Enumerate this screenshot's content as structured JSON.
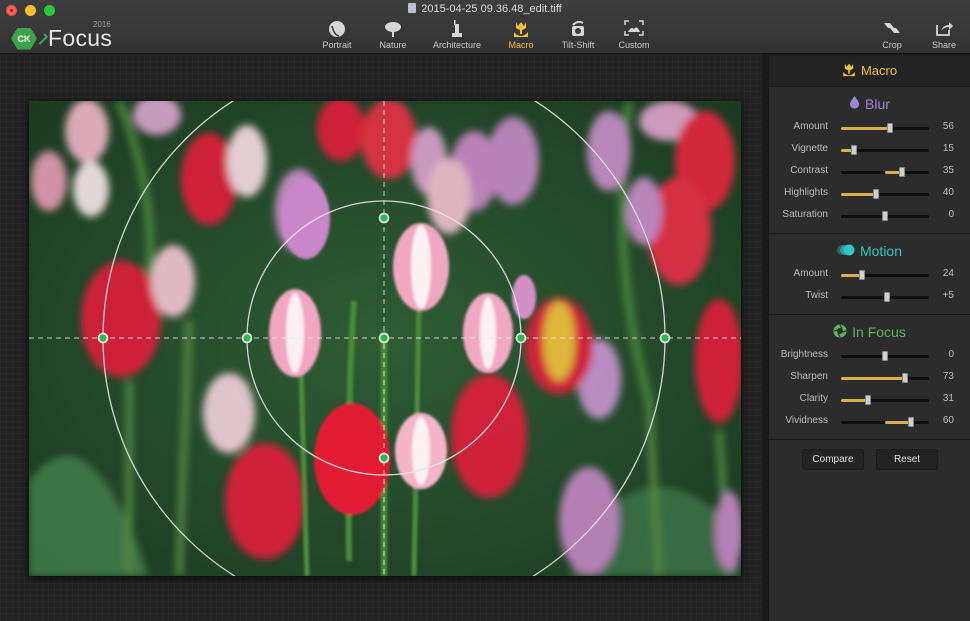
{
  "window": {
    "document_title": "2015-04-25 09.36.48_edit.tiff"
  },
  "app": {
    "logo_badge": "CK",
    "name": "Focus",
    "year": "2016"
  },
  "toolbar": {
    "presets": [
      {
        "label": "Portrait",
        "icon": "portrait-icon",
        "active": false
      },
      {
        "label": "Nature",
        "icon": "tree-icon",
        "active": false
      },
      {
        "label": "Architecture",
        "icon": "statue-icon",
        "active": false
      },
      {
        "label": "Macro",
        "icon": "flower-icon",
        "active": true
      },
      {
        "label": "Tilt-Shift",
        "icon": "tilt-shift-icon",
        "active": false
      },
      {
        "label": "Custom",
        "icon": "custom-icon",
        "active": false
      }
    ],
    "crop_label": "Crop",
    "share_label": "Share",
    "accent_color": "#f2c12e"
  },
  "sidebar": {
    "header": "Macro",
    "sections": [
      {
        "title": "Blur",
        "icon": "droplet-icon",
        "color": "#9b86d6",
        "sliders": [
          {
            "label": "Amount",
            "value": "56",
            "fill_from": 0,
            "fill_to": 0.56
          },
          {
            "label": "Vignette",
            "value": "15",
            "fill_from": 0,
            "fill_to": 0.15
          },
          {
            "label": "Contrast",
            "value": "35",
            "fill_from": 0.5,
            "fill_to": 0.69
          },
          {
            "label": "Highlights",
            "value": "40",
            "fill_from": 0,
            "fill_to": 0.4
          },
          {
            "label": "Saturation",
            "value": "0",
            "fill_from": 0.5,
            "fill_to": 0.5
          }
        ]
      },
      {
        "title": "Motion",
        "icon": "motion-icon",
        "color": "#2ec8c4",
        "sliders": [
          {
            "label": "Amount",
            "value": "24",
            "fill_from": 0,
            "fill_to": 0.24
          },
          {
            "label": "Twist",
            "value": "+5",
            "fill_from": 0.5,
            "fill_to": 0.52
          }
        ]
      },
      {
        "title": "In Focus",
        "icon": "aperture-icon",
        "color": "#5cb85c",
        "sliders": [
          {
            "label": "Brightness",
            "value": "0",
            "fill_from": 0.5,
            "fill_to": 0.5
          },
          {
            "label": "Sharpen",
            "value": "73",
            "fill_from": 0,
            "fill_to": 0.73
          },
          {
            "label": "Clarity",
            "value": "31",
            "fill_from": 0,
            "fill_to": 0.31
          },
          {
            "label": "Vividness",
            "value": "60",
            "fill_from": 0.5,
            "fill_to": 0.8
          }
        ]
      }
    ],
    "compare_label": "Compare",
    "reset_label": "Reset",
    "slider_fill_color": "#d8b14a"
  },
  "focus_overlay": {
    "handle_color": "#2db84a",
    "guide_color": "#e6e6e6"
  }
}
